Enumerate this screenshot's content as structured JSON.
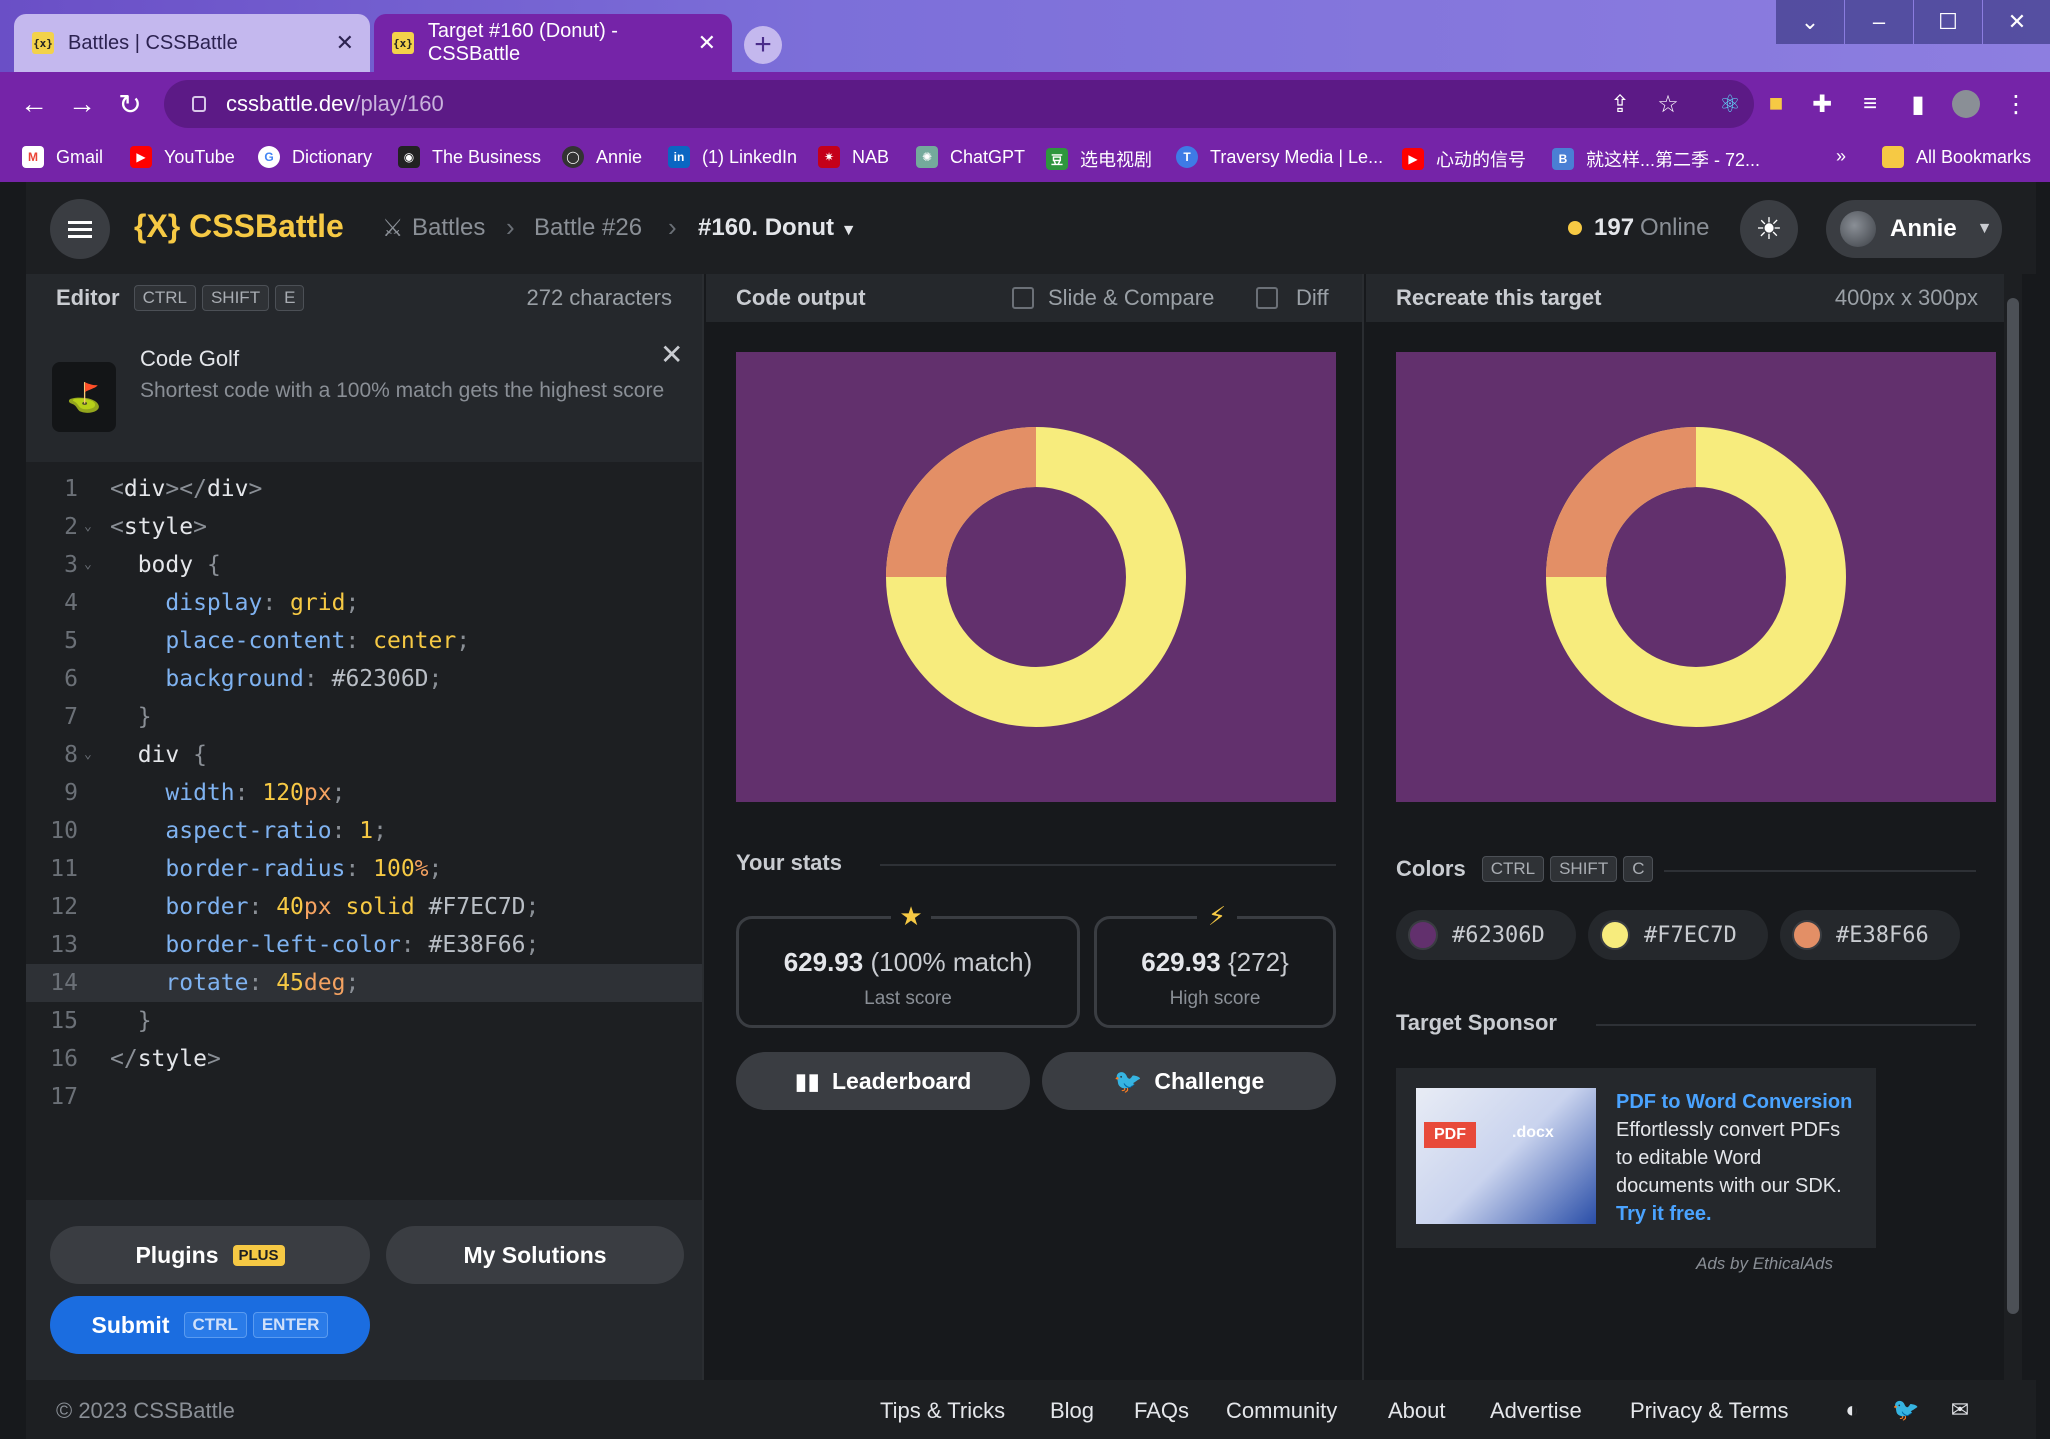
{
  "browser": {
    "tabs": [
      {
        "title": "Battles | CSSBattle",
        "favicon": "{x}"
      },
      {
        "title": "Target #160 (Donut) - CSSBattle",
        "favicon": "{x}"
      }
    ],
    "url_host": "cssbattle.dev",
    "url_path": "/play/160",
    "bookmarks": [
      "Gmail",
      "YouTube",
      "Dictionary",
      "The Business",
      "Annie",
      "(1) LinkedIn",
      "NAB",
      "ChatGPT",
      "选电视剧",
      "Traversy Media | Le...",
      "心动的信号",
      "就这样...第二季 - 72..."
    ],
    "bookmarks_more": "»",
    "all_bookmarks": "All Bookmarks"
  },
  "header": {
    "logo": "{X} CSSBattle",
    "breadcrumbs": [
      "Battles",
      "Battle #26",
      "#160. Donut"
    ],
    "online_count": "197",
    "online_label": "Online",
    "user": "Annie"
  },
  "editor": {
    "title": "Editor",
    "shortcut": [
      "CTRL",
      "SHIFT",
      "E"
    ],
    "char_count": "272 characters",
    "golf_title": "Code Golf",
    "golf_text": "Shortest code with a 100% match gets the highest score",
    "active_line": 14,
    "lines": [
      "<div></div>",
      "<style>",
      "  body {",
      "    display: grid;",
      "    place-content: center;",
      "    background: #62306D;",
      "  }",
      "  div {",
      "    width: 120px;",
      "    aspect-ratio: 1;",
      "    border-radius: 100%;",
      "    border: 40px solid #F7EC7D;",
      "    border-left-color: #E38F66;",
      "    rotate: 45deg;",
      "  }",
      "</style>",
      ""
    ],
    "plugins_label": "Plugins",
    "plus_badge": "PLUS",
    "solutions_label": "My Solutions",
    "submit_label": "Submit",
    "submit_shortcut": [
      "CTRL",
      "ENTER"
    ]
  },
  "output": {
    "title": "Code output",
    "slide_compare": "Slide & Compare",
    "diff": "Diff",
    "stats_title": "Your stats",
    "last_score_value": "629.93",
    "last_score_match": "(100% match)",
    "last_score_label": "Last score",
    "high_score_value": "629.93",
    "high_score_chars": "{272}",
    "high_score_label": "High score",
    "leaderboard_label": "Leaderboard",
    "challenge_label": "Challenge"
  },
  "target": {
    "title": "Recreate this target",
    "size": "400px x 300px",
    "colors_title": "Colors",
    "colors_shortcut": [
      "CTRL",
      "SHIFT",
      "C"
    ],
    "colors": [
      "#62306D",
      "#F7EC7D",
      "#E38F66"
    ],
    "sponsor_title": "Target Sponsor",
    "sponsor_link": "PDF to Word Conversion",
    "sponsor_text": "Effortlessly convert PDFs to editable Word documents with our SDK.",
    "sponsor_cta": "Try it free.",
    "sponsor_img_pdf": "PDF",
    "sponsor_img_docx": ".docx",
    "ads_by": "Ads by EthicalAds"
  },
  "footer": {
    "copyright": "© 2023 CSSBattle",
    "links": [
      "Tips & Tricks",
      "Blog",
      "FAQs",
      "Community",
      "About",
      "Advertise",
      "Privacy & Terms"
    ]
  }
}
